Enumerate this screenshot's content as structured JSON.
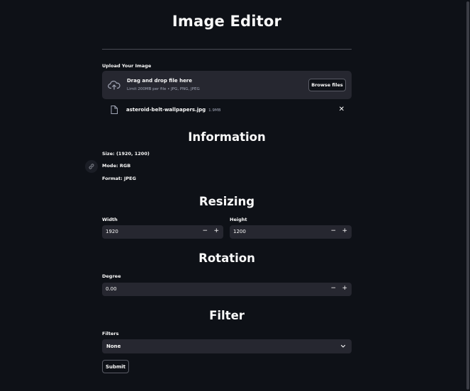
{
  "app": {
    "title": "Image Editor"
  },
  "upload": {
    "label": "Upload Your Image",
    "drop_title": "Drag and drop file here",
    "drop_subtitle": "Limit 200MB per file • JPG, PNG, JPEG",
    "browse_label": "Browse files",
    "file": {
      "name": "asteroid-belt-wallpapers.jpg",
      "size": "1.9MB",
      "close": "✕"
    }
  },
  "information": {
    "title": "Information",
    "size": "Size: (1920, 1200)",
    "mode": "Mode: RGB",
    "format": "Format: JPEG"
  },
  "resizing": {
    "title": "Resizing",
    "width_label": "Width",
    "width_value": "1920",
    "height_label": "Height",
    "height_value": "1200",
    "minus": "−",
    "plus": "+"
  },
  "rotation": {
    "title": "Rotation",
    "degree_label": "Degree",
    "degree_value": "0.00",
    "minus": "−",
    "plus": "+"
  },
  "filter": {
    "title": "Filter",
    "filters_label": "Filters",
    "selected": "None"
  },
  "submit_label": "Submit",
  "icons": {
    "upload": "cloud-upload-icon",
    "file": "file-icon",
    "anchor": "link-icon",
    "dropdown": "chevron-down-icon"
  }
}
